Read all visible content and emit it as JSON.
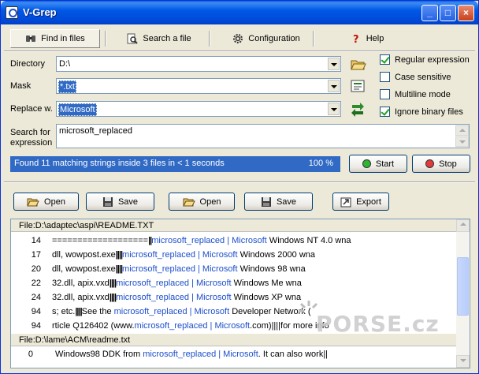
{
  "window": {
    "title": "V-Grep"
  },
  "tabs": [
    {
      "label": "Find in files",
      "icon": "binoculars-icon"
    },
    {
      "label": "Search a file",
      "icon": "magnifier-icon"
    },
    {
      "label": "Configuration",
      "icon": "gear-icon"
    },
    {
      "label": "Help",
      "icon": "question-icon"
    }
  ],
  "form": {
    "directory_label": "Directory",
    "directory_value": "D:\\",
    "mask_label": "Mask",
    "mask_value": "*.txt",
    "replace_label": "Replace w.",
    "replace_value": "Microsoft",
    "search_label_1": "Search for",
    "search_label_2": "expression",
    "search_value": "microsoft_replaced"
  },
  "options": [
    {
      "label": "Regular expression",
      "checked": true
    },
    {
      "label": "Case sensitive",
      "checked": false
    },
    {
      "label": "Multiline mode",
      "checked": false
    },
    {
      "label": "Ignore binary files",
      "checked": true
    }
  ],
  "status": {
    "message": "Found 11 matching strings inside 3 files in < 1 seconds",
    "progress_text": "100 %",
    "progress": 1.0
  },
  "actions": {
    "start": "Start",
    "stop": "Stop",
    "start_color": "#2fb52f",
    "stop_color": "#e23b3b"
  },
  "toolbar": {
    "open1": "Open",
    "save1": "Save",
    "open2": "Open",
    "save2": "Save",
    "export": "Export"
  },
  "results": {
    "files": [
      {
        "header": "File:D:\\adaptec\\aspi\\README.TXT",
        "rows": [
          {
            "line": "14",
            "pre": "===================",
            "bar": "||",
            "hit": "microsoft_replaced | Microsoft",
            "post": " Windows NT 4.0  wna"
          },
          {
            "line": "17",
            "pre": "dll, wowpost.exe",
            "bar": "||||",
            "hit": "microsoft_replaced | Microsoft",
            "post": " Windows 2000    wna"
          },
          {
            "line": "20",
            "pre": "dll, wowpost.exe",
            "bar": "||||",
            "hit": "microsoft_replaced | Microsoft",
            "post": " Windows 98     wna"
          },
          {
            "line": "22",
            "pre": "32.dll, apix.vxd",
            "bar": "||||",
            "hit": "microsoft_replaced | Microsoft",
            "post": " Windows Me      wna"
          },
          {
            "line": "24",
            "pre": "32.dll, apix.vxd",
            "bar": "||||",
            "hit": "microsoft_replaced | Microsoft",
            "post": " Windows XP      wna"
          },
          {
            "line": "94",
            "pre": "s;  etc.",
            "bar": "||||",
            "hit_pre": "See the ",
            "hit": "microsoft_replaced | Microsoft",
            "post": " Developer Network ("
          },
          {
            "line": "94",
            "pre": "rticle Q126402 (www.",
            "bar": "",
            "hit": "microsoft_replaced | Microsoft",
            "post": ".com)||||for more info"
          }
        ]
      },
      {
        "header": "File:D:\\lame\\ACM\\readme.txt",
        "rows": [
          {
            "line": "0",
            "pre": "Windows98 DDK from ",
            "bar": "",
            "hit": "microsoft_replaced | Microsoft",
            "post": ". It can also work||"
          }
        ]
      }
    ]
  },
  "watermark": "PORSE.cz"
}
